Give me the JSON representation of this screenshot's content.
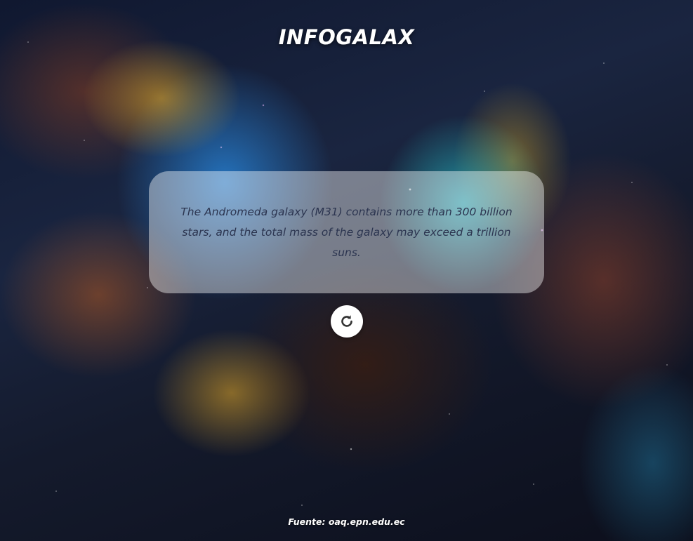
{
  "app": {
    "title": "INFOGALAX"
  },
  "fact_card": {
    "text": "The Andromeda galaxy (M31) contains more than 300 billion stars, and the total mass of the galaxy may exceed a trillion suns."
  },
  "refresh_button": {
    "icon": "refresh-icon"
  },
  "footer": {
    "source": "Fuente: oaq.epn.edu.ec"
  },
  "colors": {
    "title": "#ffffff",
    "card_text": "#2c3550",
    "button_bg": "#ffffff",
    "icon": "#333333"
  }
}
